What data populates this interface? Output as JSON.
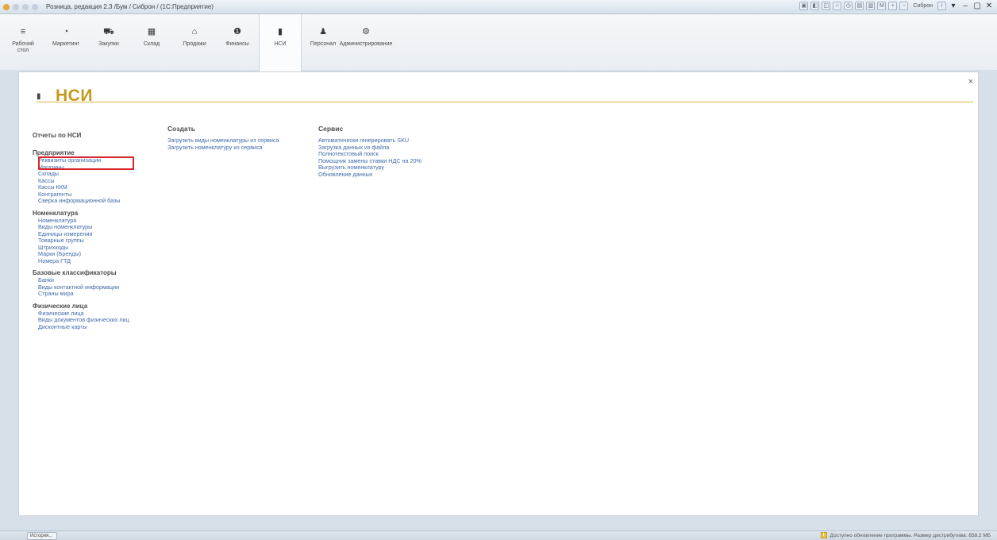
{
  "window": {
    "title": "Розница, редакция 2.3 /Бум / Сиброн / (1С:Предприятие)",
    "user": "Сиброн"
  },
  "sections": [
    {
      "label": "Рабочий стол",
      "icon": "≡",
      "name": "desktop"
    },
    {
      "label": "Маркетинг",
      "icon": "◔",
      "name": "marketing"
    },
    {
      "label": "Закупки",
      "icon": "⛟",
      "name": "purchases"
    },
    {
      "label": "Склад",
      "icon": "▦",
      "name": "warehouse"
    },
    {
      "label": "Продажи",
      "icon": "⌂",
      "name": "sales"
    },
    {
      "label": "Финансы",
      "icon": "❶",
      "name": "finance"
    },
    {
      "label": "НСИ",
      "icon": "▮",
      "name": "nsi"
    },
    {
      "label": "Персонал",
      "icon": "♟",
      "name": "personnel"
    },
    {
      "label": "Администрирование",
      "icon": "⚙",
      "name": "administration"
    }
  ],
  "page": {
    "title": "НСИ",
    "close": "×"
  },
  "column1": {
    "reports": "Отчеты по НСИ",
    "groups": [
      {
        "title": "Предприятие",
        "items": [
          "Реквизиты организации",
          "Магазины",
          "Склады",
          "Кассы",
          "Кассы ККМ",
          "Контрагенты",
          "Сверка информационной базы"
        ]
      },
      {
        "title": "Номенклатура",
        "items": [
          "Номенклатура",
          "Виды номенклатуры",
          "Единицы измерения",
          "Товарные группы",
          "Штрихкоды",
          "Марки (Бренды)",
          "Номера ГТД"
        ]
      },
      {
        "title": "Базовые классификаторы",
        "items": [
          "Банки",
          "Виды контактной информации",
          "Страны мира"
        ]
      },
      {
        "title": "Физические лица",
        "items": [
          "Физические лица",
          "Виды документов физических лиц",
          "Дисконтные карты"
        ]
      }
    ]
  },
  "column2": {
    "title": "Создать",
    "items": [
      "Загрузить виды номенклатуры из сервиса",
      "Загрузить номенклатуру из сервиса"
    ]
  },
  "column3": {
    "title": "Сервис",
    "items": [
      "Автоматически генерировать SKU",
      "Загрузка данных из файла",
      "Полнотекстовый поиск",
      "Помощник замены ставки НДС на 20%",
      "Выгрузить номенклатуру",
      "Обновление данных"
    ]
  },
  "statusbar": {
    "history": "История...",
    "message": "Доступно обновление программы. Размер дистрибутива: 658.2 МБ"
  },
  "colors": {
    "accent": "#c49a1c",
    "link": "#3f6aa8",
    "highlight": "#d6262b"
  }
}
